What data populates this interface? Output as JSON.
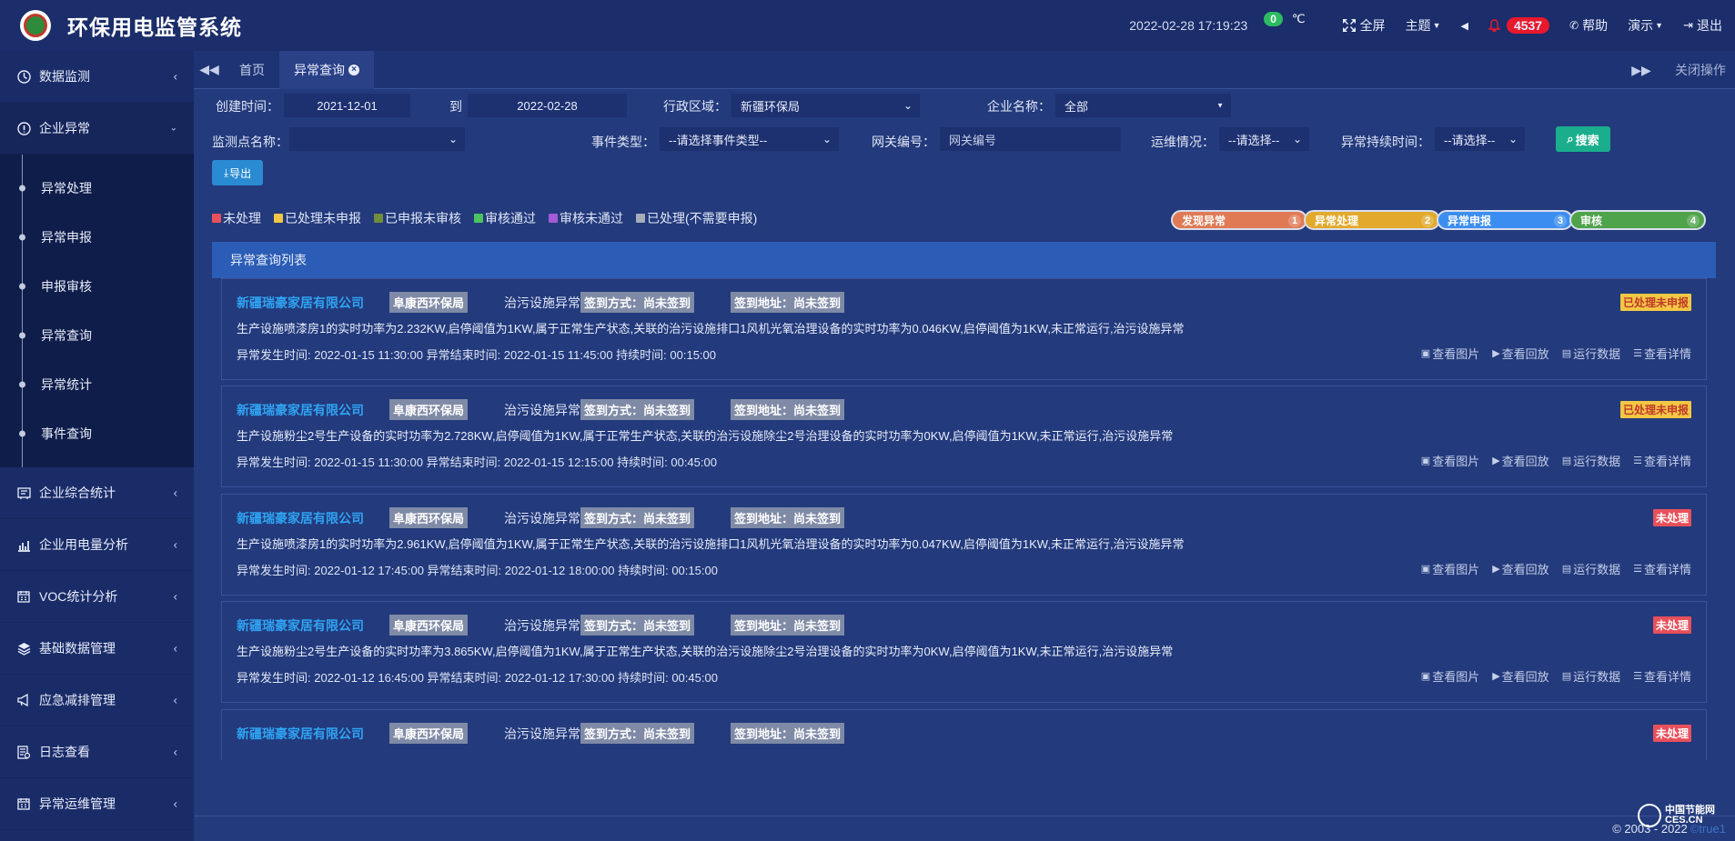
{
  "app": {
    "title": "环保用电监管系统"
  },
  "topbar": {
    "datetime": "2022-02-28  17:19:23",
    "temp_value": "0",
    "temp_unit": "℃",
    "fullscreen": "全屏",
    "theme": "主题",
    "alarm_count": "4537",
    "help": "帮助",
    "demo": "演示",
    "logout": "退出"
  },
  "sidebar": {
    "items": [
      {
        "label": "数据监测",
        "icon": "dashboard-icon"
      },
      {
        "label": "企业异常",
        "icon": "info-circle-icon"
      },
      {
        "label": "企业综合统计",
        "icon": "stats-icon"
      },
      {
        "label": "企业用电量分析",
        "icon": "bar-chart-icon"
      },
      {
        "label": "VOC统计分析",
        "icon": "calendar-icon"
      },
      {
        "label": "基础数据管理",
        "icon": "layers-icon"
      },
      {
        "label": "应急减排管理",
        "icon": "bullhorn-icon"
      },
      {
        "label": "日志查看",
        "icon": "log-icon"
      },
      {
        "label": "异常运维管理",
        "icon": "calendar-icon"
      }
    ],
    "submenu": [
      "异常处理",
      "异常申报",
      "申报审核",
      "异常查询",
      "异常统计",
      "事件查询"
    ]
  },
  "tabs": {
    "home": "首页",
    "active": "异常查询",
    "close_ops": "关闭操作"
  },
  "filters": {
    "created_label": "创建时间：",
    "start_date": "2021-12-01",
    "to": "到",
    "end_date": "2022-02-28",
    "region_label": "行政区域：",
    "region_value": "新疆环保局",
    "company_label": "企业名称：",
    "company_value": "全部",
    "point_label": "监测点名称：",
    "point_value": "",
    "event_label": "事件类型：",
    "event_value": "--请选择事件类型--",
    "gateway_label": "网关编号：",
    "gateway_placeholder": "网关编号",
    "ops_label": "运维情况：",
    "ops_value": "--请选择--",
    "duration_label": "异常持续时间：",
    "duration_value": "--请选择--",
    "search_btn": "搜索",
    "export_btn": "导出"
  },
  "legend": [
    {
      "label": "未处理",
      "color": "#e8505b"
    },
    {
      "label": "已处理未申报",
      "color": "#f2c744"
    },
    {
      "label": "已申报未审核",
      "color": "#6f8d3c"
    },
    {
      "label": "审核通过",
      "color": "#4cc45d"
    },
    {
      "label": "审核未通过",
      "color": "#a35ad6"
    },
    {
      "label": "已处理(不需要申报)",
      "color": "#a6acb8"
    }
  ],
  "steps": [
    {
      "label": "发现异常",
      "num": "1",
      "color": "#e07a55"
    },
    {
      "label": "异常处理",
      "num": "2",
      "color": "#e2a92c"
    },
    {
      "label": "异常申报",
      "num": "3",
      "color": "#3b8ef0"
    },
    {
      "label": "审核",
      "num": "4",
      "color": "#4fa34a"
    }
  ],
  "list": {
    "title": "异常查询列表",
    "actions": [
      "查看图片",
      "查看回放",
      "运行数据",
      "查看详情"
    ],
    "cards": [
      {
        "company": "新疆瑞豪家居有限公司",
        "agency": "阜康西环保局",
        "type": "治污设施异常",
        "sign_method": "签到方式：尚未签到",
        "sign_addr": "签到地址：尚未签到",
        "status": "已处理未申报",
        "status_color": "#f2c744",
        "status_text_color": "#c0392b",
        "desc": "生产设施喷漆房1的实时功率为2.232KW,启停阈值为1KW,属于正常生产状态,关联的治污设施排口1风机光氧治理设备的实时功率为0.046KW,启停阈值为1KW,未正常运行,治污设施异常",
        "times": "异常发生时间: 2022-01-15 11:30:00 异常结束时间: 2022-01-15 11:45:00 持续时间: 00:15:00"
      },
      {
        "company": "新疆瑞豪家居有限公司",
        "agency": "阜康西环保局",
        "type": "治污设施异常",
        "sign_method": "签到方式：尚未签到",
        "sign_addr": "签到地址：尚未签到",
        "status": "已处理未申报",
        "status_color": "#f2c744",
        "status_text_color": "#c0392b",
        "desc": "生产设施粉尘2号生产设备的实时功率为2.728KW,启停阈值为1KW,属于正常生产状态,关联的治污设施除尘2号治理设备的实时功率为0KW,启停阈值为1KW,未正常运行,治污设施异常",
        "times": "异常发生时间: 2022-01-15 11:30:00 异常结束时间: 2022-01-15 12:15:00 持续时间: 00:45:00"
      },
      {
        "company": "新疆瑞豪家居有限公司",
        "agency": "阜康西环保局",
        "type": "治污设施异常",
        "sign_method": "签到方式：尚未签到",
        "sign_addr": "签到地址：尚未签到",
        "status": "未处理",
        "status_color": "#e8505b",
        "status_text_color": "#ffffff",
        "desc": "生产设施喷漆房1的实时功率为2.961KW,启停阈值为1KW,属于正常生产状态,关联的治污设施排口1风机光氧治理设备的实时功率为0.047KW,启停阈值为1KW,未正常运行,治污设施异常",
        "times": "异常发生时间: 2022-01-12 17:45:00 异常结束时间: 2022-01-12 18:00:00 持续时间: 00:15:00"
      },
      {
        "company": "新疆瑞豪家居有限公司",
        "agency": "阜康西环保局",
        "type": "治污设施异常",
        "sign_method": "签到方式：尚未签到",
        "sign_addr": "签到地址：尚未签到",
        "status": "未处理",
        "status_color": "#e8505b",
        "status_text_color": "#ffffff",
        "desc": "生产设施粉尘2号生产设备的实时功率为3.865KW,启停阈值为1KW,属于正常生产状态,关联的治污设施除尘2号治理设备的实时功率为0KW,启停阈值为1KW,未正常运行,治污设施异常",
        "times": "异常发生时间: 2022-01-12 16:45:00 异常结束时间: 2022-01-12 17:30:00 持续时间: 00:45:00"
      },
      {
        "company": "新疆瑞豪家居有限公司",
        "agency": "阜康西环保局",
        "type": "治污设施异常",
        "sign_method": "签到方式：尚未签到",
        "sign_addr": "签到地址：尚未签到",
        "status": "未处理",
        "status_color": "#e8505b",
        "status_text_color": "#ffffff",
        "desc": "",
        "times": ""
      }
    ]
  },
  "footer": {
    "copyright": "© 2003 - 2022",
    "version": "©true1"
  },
  "watermark": {
    "line1": "中国节能网",
    "line2": "CES.CN"
  }
}
